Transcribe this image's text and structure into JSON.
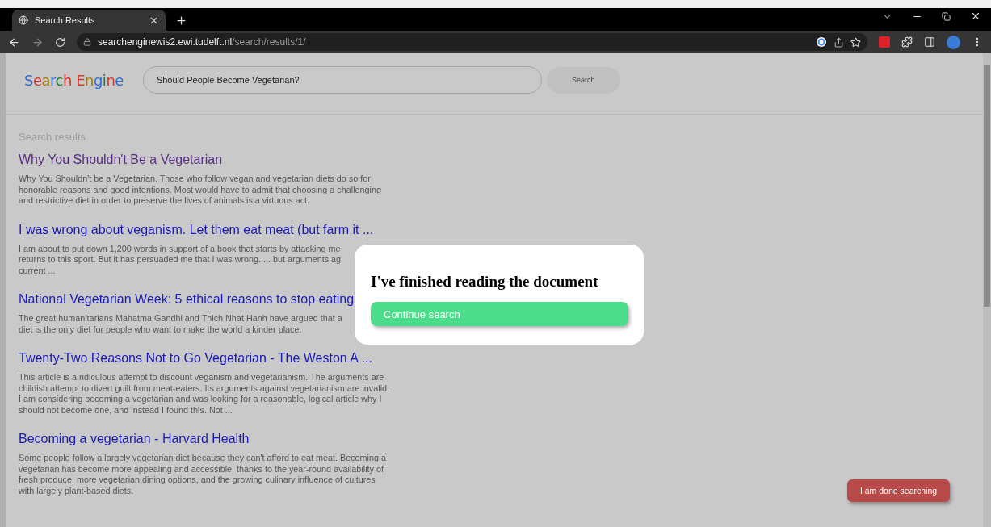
{
  "browser": {
    "tab_title": "Search Results",
    "url_host": "searchenginewis2.ewi.tudelft.nl",
    "url_path": "/search/results/1/"
  },
  "header": {
    "logo": "Search Engine",
    "query": "Should People Become Vegetarian?",
    "search_button": "Search"
  },
  "results_heading": "Search results",
  "results": [
    {
      "title": "Why You Shouldn't Be a Vegetarian",
      "visited": true,
      "snippet_lines": [
        "Why You Shouldn't be a Vegetarian. Those who follow vegan and vegetarian diets do so for",
        "honorable reasons and good intentions. Most would have to admit that choosing a challenging",
        "and restrictive diet in order to preserve the lives of animals is a virtuous act."
      ]
    },
    {
      "title": "I was wrong about veganism. Let them eat meat (but farm it ...",
      "visited": false,
      "snippet_lines": [
        "I am about to put down 1,200 words in support of a book that starts by attacking me",
        "returns to this sport. But it has persuaded me that I was wrong. ... but arguments ag",
        "current ..."
      ]
    },
    {
      "title": "National Vegetarian Week: 5 ethical reasons to stop eating",
      "visited": false,
      "snippet_lines": [
        "The great humanitarians Mahatma Gandhi and Thich Nhat Hanh have argued that a",
        "diet is the only diet for people who want to make the world a kinder place."
      ]
    },
    {
      "title": "Twenty-Two Reasons Not to Go Vegetarian - The Weston A ...",
      "visited": false,
      "snippet_lines": [
        "This article is a ridiculous attempt to discount veganism and vegetarianism. The arguments are",
        "childish attempt to divert guilt from meat-eaters. Its arguments against vegetarianism are invalid.",
        "I am considering becoming a vegetarian and was looking for a reasonable, logical article why I",
        "should not become one, and instead I found this. Not ..."
      ]
    },
    {
      "title": "Becoming a vegetarian - Harvard Health",
      "visited": false,
      "snippet_lines": [
        "Some people follow a largely vegetarian diet because they can't afford to eat meat. Becoming a",
        "vegetarian has become more appealing and accessible, thanks to the year-round availability of",
        "fresh produce, more vegetarian dining options, and the growing culinary influence of cultures",
        "with largely plant-based diets."
      ]
    }
  ],
  "modal": {
    "heading": "I've finished reading the document",
    "button": "Continue search"
  },
  "done_button": "I am done searching"
}
